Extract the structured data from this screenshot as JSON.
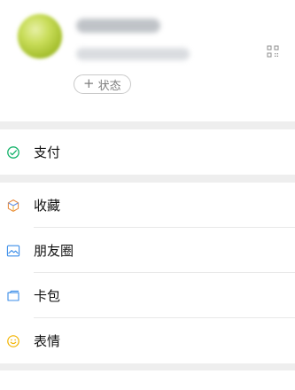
{
  "profile": {
    "status_label": "状态",
    "avatar_icon": "avatar-blurred",
    "qr_icon": "qr-code-icon"
  },
  "menu": {
    "pay": {
      "label": "支付",
      "icon": "pay-icon",
      "color": "#14b26a"
    },
    "favorites": {
      "label": "收藏",
      "icon": "favorites-icon",
      "color": "#e98b3f"
    },
    "moments": {
      "label": "朋友圈",
      "icon": "moments-icon",
      "color": "#3b8de8"
    },
    "cards": {
      "label": "卡包",
      "icon": "cards-icon",
      "color": "#3b8de8"
    },
    "stickers": {
      "label": "表情",
      "icon": "stickers-icon",
      "color": "#f2b400"
    }
  }
}
